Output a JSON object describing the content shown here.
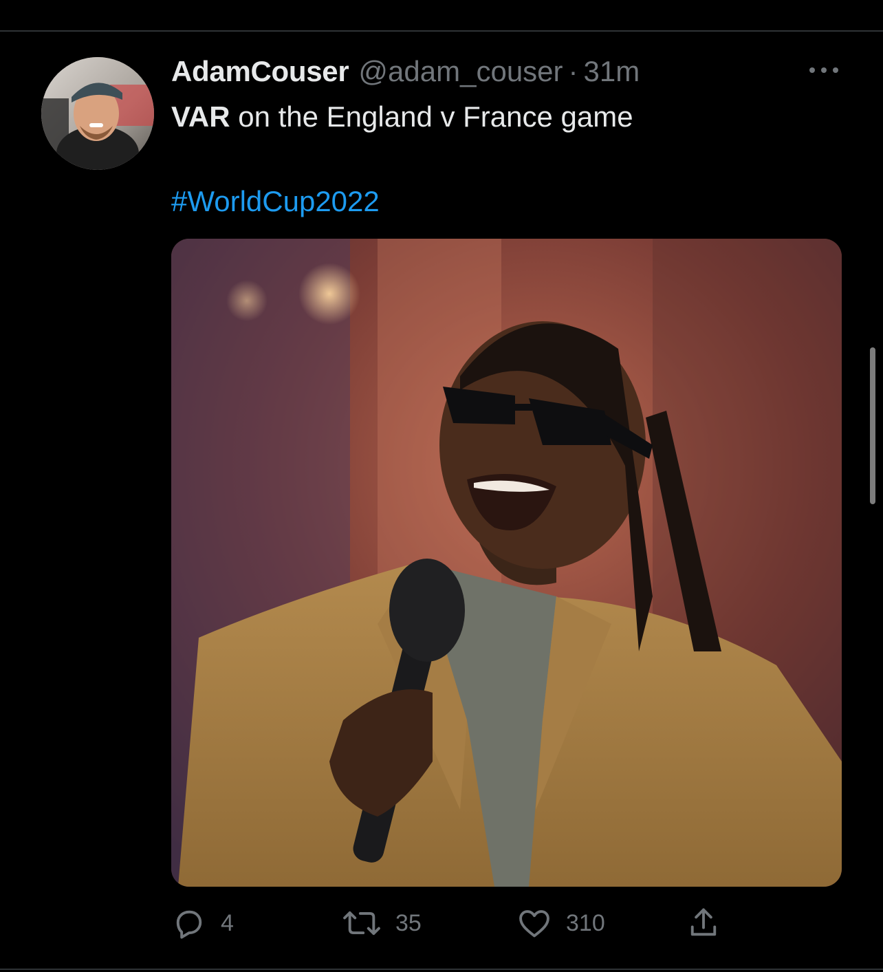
{
  "tweet": {
    "display_name": "AdamCouser",
    "handle": "@adam_couser",
    "separator": "·",
    "time": "31m",
    "text_bold": "VAR",
    "text_rest": " on the England v France game",
    "hashtag": "#WorldCup2022",
    "media": {
      "subject": "man in sunglasses and tan suit singing into microphone",
      "icon": "photo"
    }
  },
  "actions": {
    "reply_count": "4",
    "retweet_count": "35",
    "like_count": "310"
  },
  "icons": {
    "more": "more-horizontal-icon",
    "reply": "reply-icon",
    "retweet": "retweet-icon",
    "like": "heart-icon",
    "share": "share-icon"
  },
  "colors": {
    "background": "#000000",
    "text": "#e7e9ea",
    "secondary": "#71767b",
    "accent": "#1d9bf0",
    "divider": "#2f3336"
  }
}
